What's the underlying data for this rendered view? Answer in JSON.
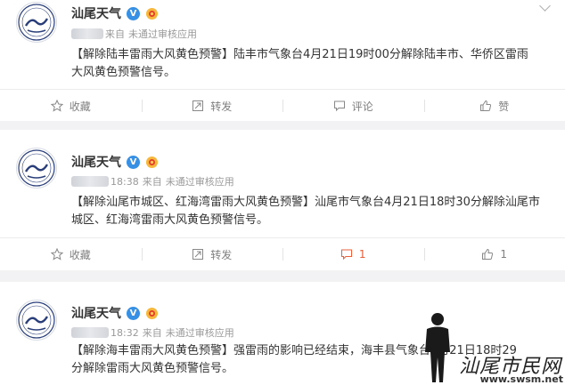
{
  "posts": [
    {
      "author": "汕尾天气",
      "source_prefix": "来自",
      "source": "未通过审核应用",
      "timestamp": "",
      "tag": "【解除陆丰雷雨大风黄色预警】",
      "body": "陆丰市气象台4月21日19时00分解除陆丰市、华侨区雷雨大风黄色预警信号。",
      "actions": {
        "fav": "收藏",
        "repost": "转发",
        "comment": "评论",
        "like": "赞"
      }
    },
    {
      "author": "汕尾天气",
      "source_prefix": "来自",
      "source": "未通过审核应用",
      "timestamp": "18:38",
      "tag": "【解除汕尾市城区、红海湾雷雨大风黄色预警】",
      "body": "汕尾市气象台4月21日18时30分解除汕尾市城区、红海湾雷雨大风黄色预警信号。",
      "actions": {
        "fav": "收藏",
        "repost": "转发",
        "comment": "1",
        "like": "1"
      }
    },
    {
      "author": "汕尾天气",
      "source_prefix": "来自",
      "source": "未通过审核应用",
      "timestamp": "18:32",
      "tag": "【解除海丰雷雨大风黄色预警】",
      "body": "强雷雨的影响已经结束，海丰县气象台4月21日18时29分解除雷雨大风黄色预警信号。"
    }
  ],
  "watermark": {
    "text": "汕尾市民网",
    "url": "www.swsm.net"
  },
  "colors": {
    "accent_comment": "#e8603c",
    "verified_blue": "#3790e3",
    "page_bg": "#f2f2f5"
  }
}
